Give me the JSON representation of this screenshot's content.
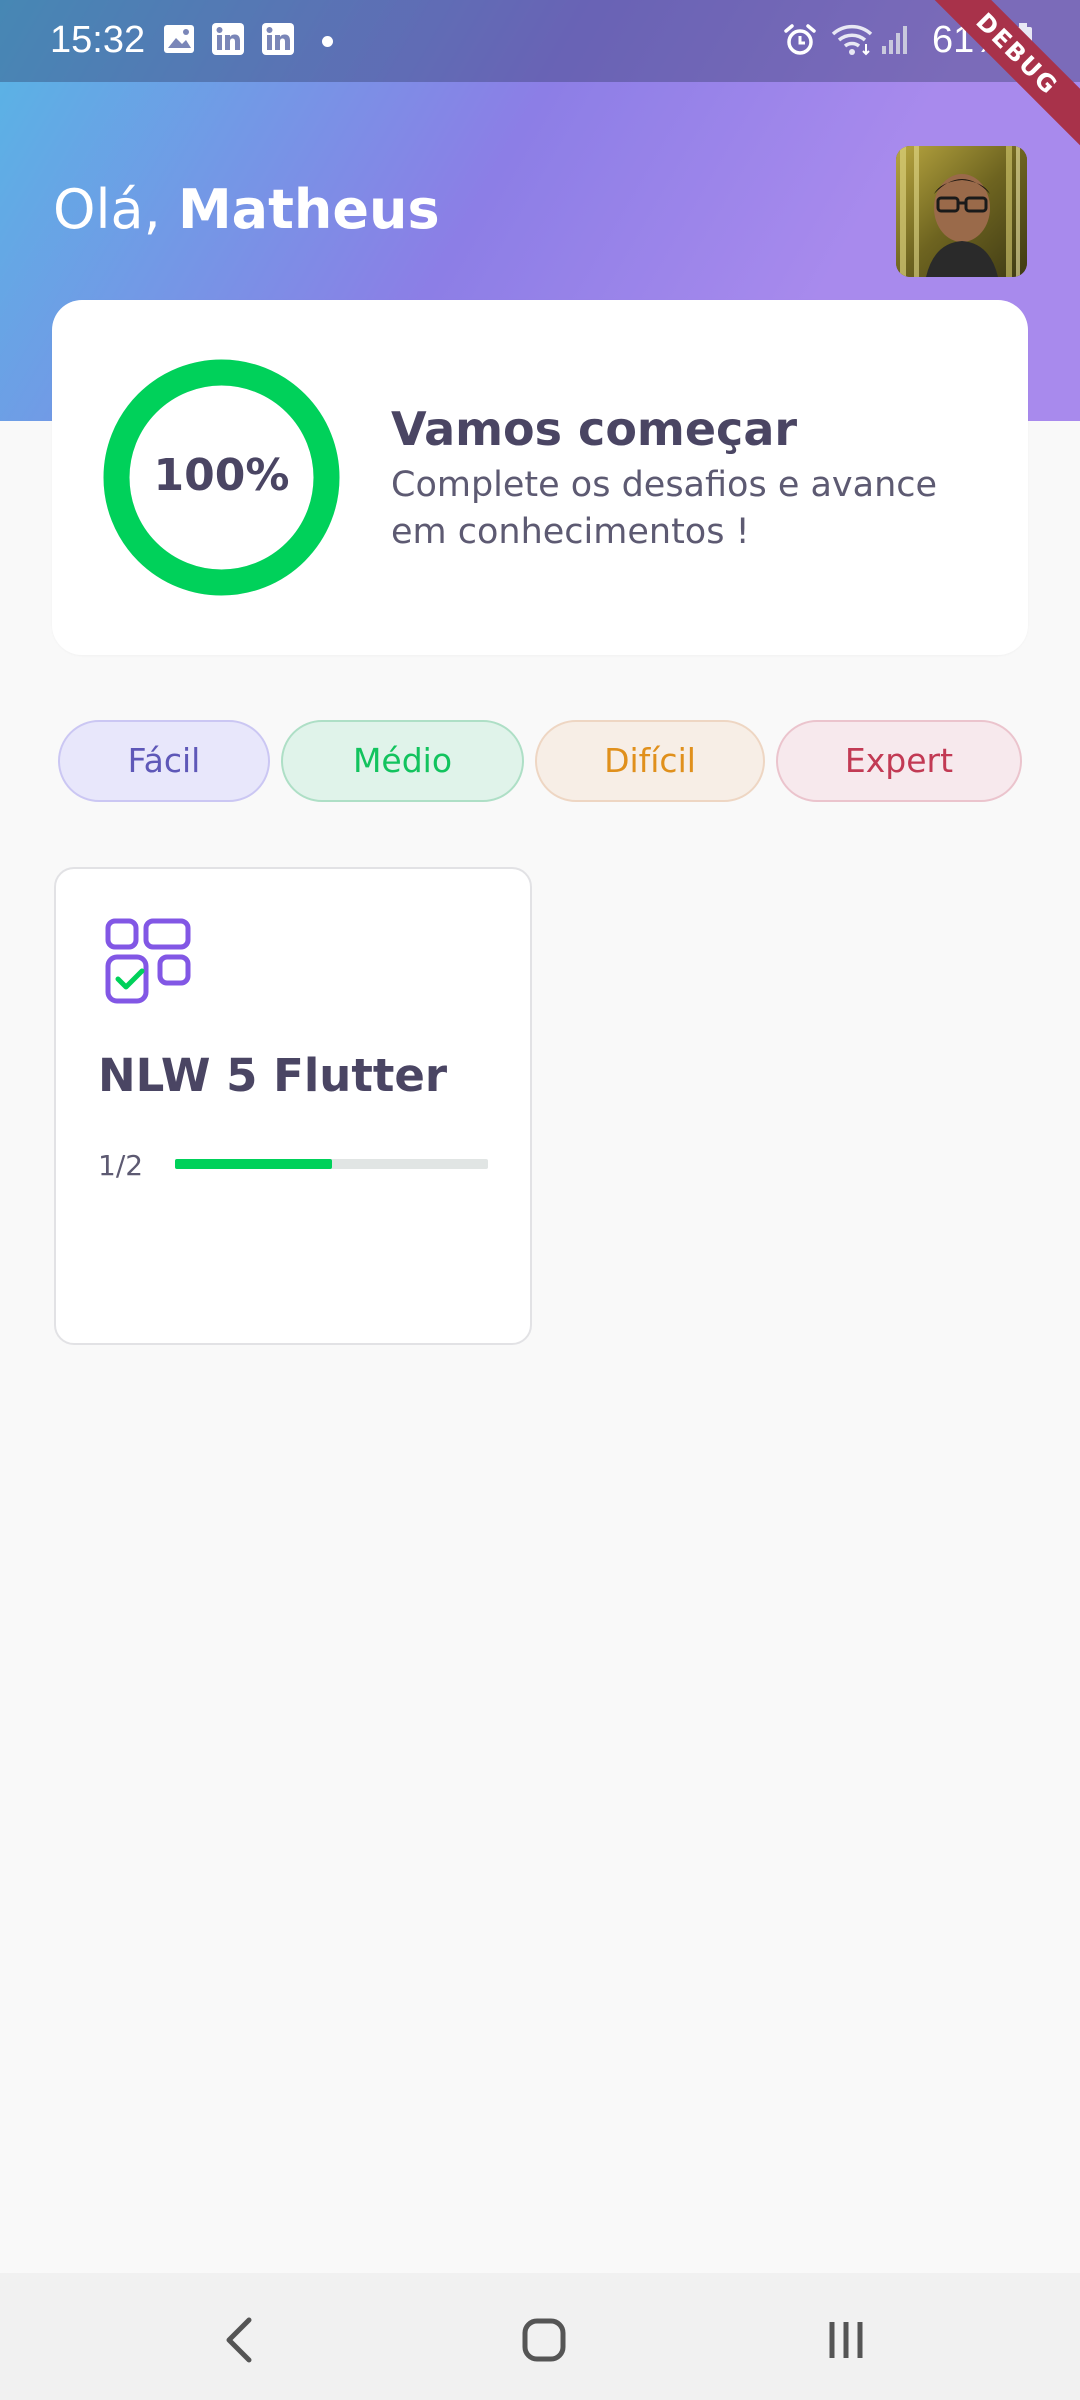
{
  "status_bar": {
    "time": "15:32",
    "battery": "61%",
    "icons": [
      "image-icon",
      "linkedin-icon",
      "linkedin-icon",
      "alarm-icon",
      "wifi-icon",
      "signal-icon",
      "battery-icon"
    ]
  },
  "debug_banner": "DEBUG",
  "header": {
    "greeting": "Olá, ",
    "user_name": "Matheus"
  },
  "score_card": {
    "percent": 1.0,
    "percent_label": "100%",
    "title": "Vamos começar",
    "subtitle": "Complete os desafios e avance em conhecimentos !"
  },
  "levels": [
    {
      "label": "Fácil"
    },
    {
      "label": "Médio"
    },
    {
      "label": "Difícil"
    },
    {
      "label": "Expert"
    }
  ],
  "quizzes": [
    {
      "title": "NLW 5 Flutter",
      "progress_text": "1/2",
      "progress": 0.5
    }
  ],
  "colors": {
    "primary": "#8257E5",
    "green": "#00D15A",
    "heading": "#4A4563",
    "text": "#5D5A72",
    "background": "#F9F9F9"
  },
  "nav": {
    "icons": [
      "back-icon",
      "home-icon",
      "recents-icon"
    ]
  }
}
